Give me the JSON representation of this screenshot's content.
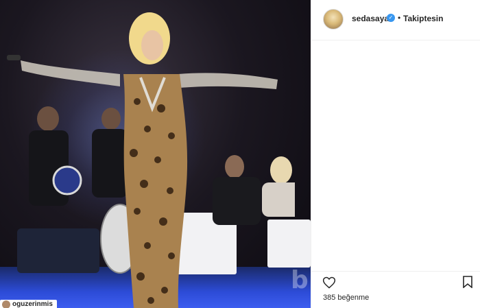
{
  "post": {
    "username": "sedasayan",
    "verified_icon": "verified-badge-icon",
    "separator": "•",
    "follow_status": "Takiptesin",
    "likes": "385 beğenme",
    "photo_credit": "oguzerinmis"
  },
  "icons": {
    "like": "heart-icon",
    "save": "bookmark-icon"
  },
  "colors": {
    "verified": "#3897f0",
    "text": "#262626",
    "divider": "#efefef"
  }
}
